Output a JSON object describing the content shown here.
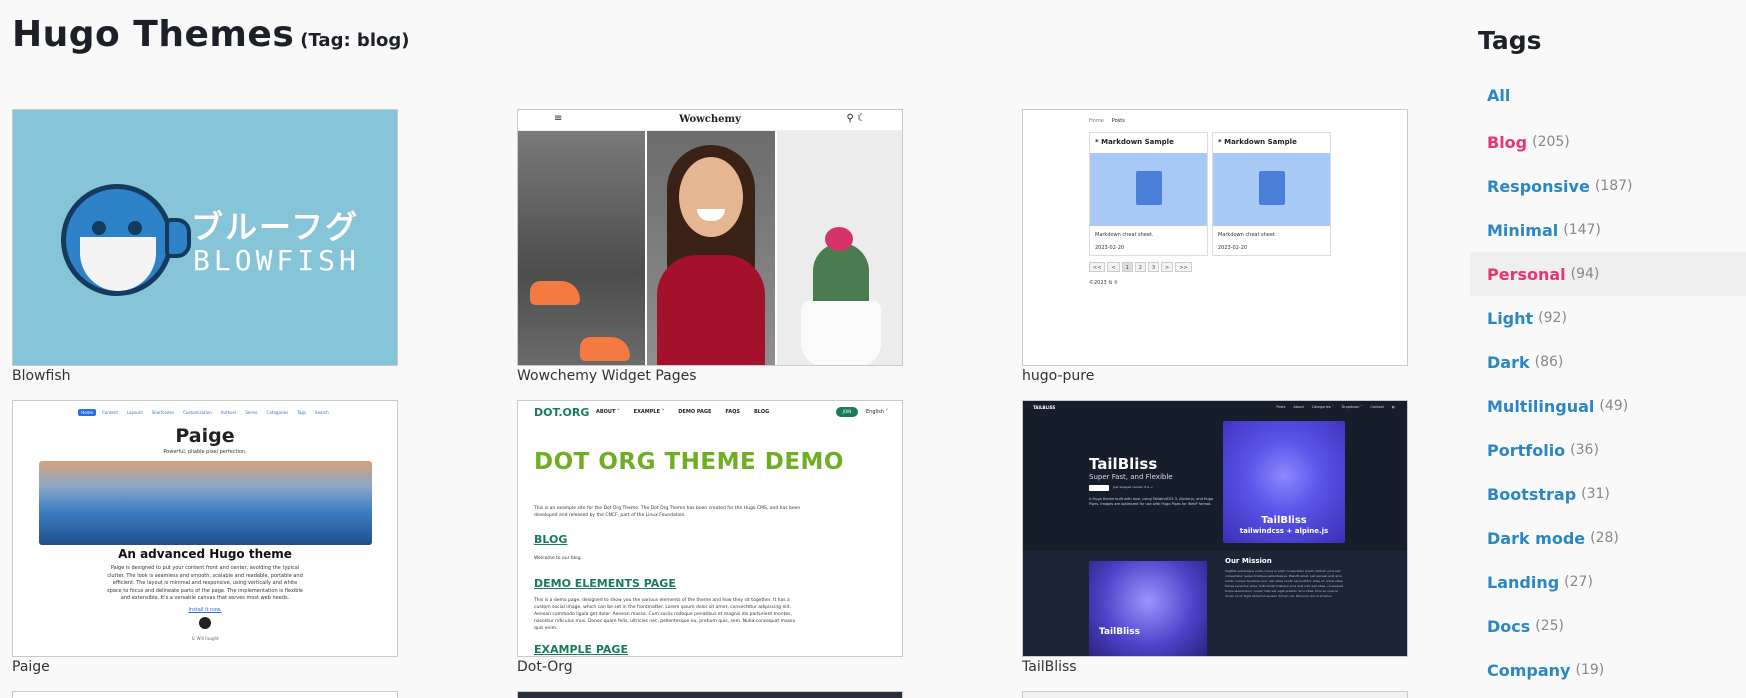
{
  "header": {
    "title": "Hugo Themes",
    "tag_label": "(Tag: blog)"
  },
  "themes": [
    {
      "name": "Blowfish",
      "thumb": {
        "jp": "ブルーフグ",
        "en": "BLOWFISH"
      }
    },
    {
      "name": "Wowchemy Widget Pages",
      "thumb": {
        "brand": "Wowchemy",
        "menu_icon": "≡",
        "search_icon": "⚲",
        "theme_icon": "☾"
      }
    },
    {
      "name": "hugo-pure",
      "thumb": {
        "nav": [
          "Home",
          "Posts"
        ],
        "cards": [
          {
            "title": "* Markdown Sample",
            "desc": "Markdown cheat sheet.",
            "date": "2023-02-20"
          },
          {
            "title": "* Markdown Sample",
            "desc": "Markdown cheat sheet",
            "date": "2023-02-20"
          }
        ],
        "pagination": [
          "<<",
          "<",
          "1",
          "2",
          "3",
          ">",
          ">>"
        ],
        "footer": "©2023 ⇅ ⚲"
      }
    },
    {
      "name": "Paige",
      "thumb": {
        "nav": [
          "Home",
          "Content",
          "Layouts",
          "Shortcodes",
          "Customization",
          "Authors",
          "Series",
          "Categories",
          "Tags",
          "Search"
        ],
        "title": "Paige",
        "subtitle": "Powerful, pliable pixel perfection.",
        "heading": "An advanced Hugo theme",
        "text": "Paige is designed to put your content front and center, avoiding the typical clutter. The look is seamless and smooth, scalable and readable, portable and efficient. The layout is minimal and responsive, using vertically and white space to focus and delineate parts of the page. The implementation is flexible and extensible. It's a versatile canvas that serves most web needs.",
        "link": "Install it now.",
        "footer": "© Will Faught"
      }
    },
    {
      "name": "Dot-Org",
      "thumb": {
        "brand": "DOT.ORG",
        "nav": [
          "ABOUT ˅",
          "EXAMPLE ˅",
          "DEMO PAGE",
          "FAQS",
          "BLOG"
        ],
        "join": "JOIN",
        "lang": "English ˅",
        "title": "DOT ORG THEME DEMO",
        "intro": "This is an example site for the Dot Org Theme. The Dot Org Theme has been created for the Hugo CMS, and has been developed and released by the CNCF, part of the Linux Foundation.",
        "blog_heading": "BLOG",
        "blog_text": "Welcome to our blog.",
        "demo_heading": "DEMO ELEMENTS PAGE",
        "demo_text": "This is a demo page, designed to show you the various elements of the theme and how they sit together. It has a custom social image, which can be set in the frontmatter. Lorem ipsum dolor sit amet, consectetur adipiscing elit. Aenean commodo ligula get dolor. Aenean massa. Cum sociis natoque penatibus et magnis dis parturient montes, nascetur ridiculus mus. Donec quam felis, ultricies nec, pellentesque eu, pretium quis, sem. Nulla consequat massa quis enim.",
        "example_heading": "EXAMPLE PAGE"
      }
    },
    {
      "name": "TailBliss",
      "thumb": {
        "logo": "TAILBLISS",
        "nav": [
          "Posts",
          "About",
          "Categories ˅",
          "Dropdown ˅",
          "Contact",
          "◐"
        ],
        "title": "TailBliss",
        "subtitle": "Super Fast, and Flexible",
        "pill_text": "Just shipped version 0.9 →",
        "desc": "A Hugo theme built with love, using TailwindCSS 3, Alpine.js, and Hugo Pipes. Images are optimized for use with Hugo Pipes for WebP format.",
        "rocket_title": "TailBliss",
        "rocket_sub": "tailwindcss + alpine.js",
        "astro_text": "TailBliss",
        "mission_title": "Our Mission",
        "mission_text": "Sagittis scelerisque nulla cursus in enim consectetur quam. Dictum urna sed consectetur neque tristique pellentesque. Blandit amet, sed aenean erat arcu morbi. Cursus faucibus nunc nisl netus morbi vel porttitor vitae ut. Amet vitae fames senectus vitae. Sollicitudin tristique eros erat odio sed vitae, consequat turpis elementum. Lorem nibh vel, eget pretium arcu vitae. Eros eu viverra donec ut ut. Eget dictumst aenean dictum vel. Rhoncus nisl ut id tellus."
      }
    }
  ],
  "sidebar": {
    "title": "Tags",
    "tags": [
      {
        "name": "All",
        "count": ""
      },
      {
        "name": "Blog",
        "count": "(205)"
      },
      {
        "name": "Responsive",
        "count": "(187)"
      },
      {
        "name": "Minimal",
        "count": "(147)"
      },
      {
        "name": "Personal",
        "count": "(94)"
      },
      {
        "name": "Light",
        "count": "(92)"
      },
      {
        "name": "Dark",
        "count": "(86)"
      },
      {
        "name": "Multilingual",
        "count": "(49)"
      },
      {
        "name": "Portfolio",
        "count": "(36)"
      },
      {
        "name": "Bootstrap",
        "count": "(31)"
      },
      {
        "name": "Dark mode",
        "count": "(28)"
      },
      {
        "name": "Landing",
        "count": "(27)"
      },
      {
        "name": "Docs",
        "count": "(25)"
      },
      {
        "name": "Company",
        "count": "(19)"
      }
    ]
  },
  "colors": {
    "link": "#2b87c4",
    "active_tag": "#e8356d",
    "page_bg": "#f9f9f9",
    "heading": "#1d2127"
  }
}
